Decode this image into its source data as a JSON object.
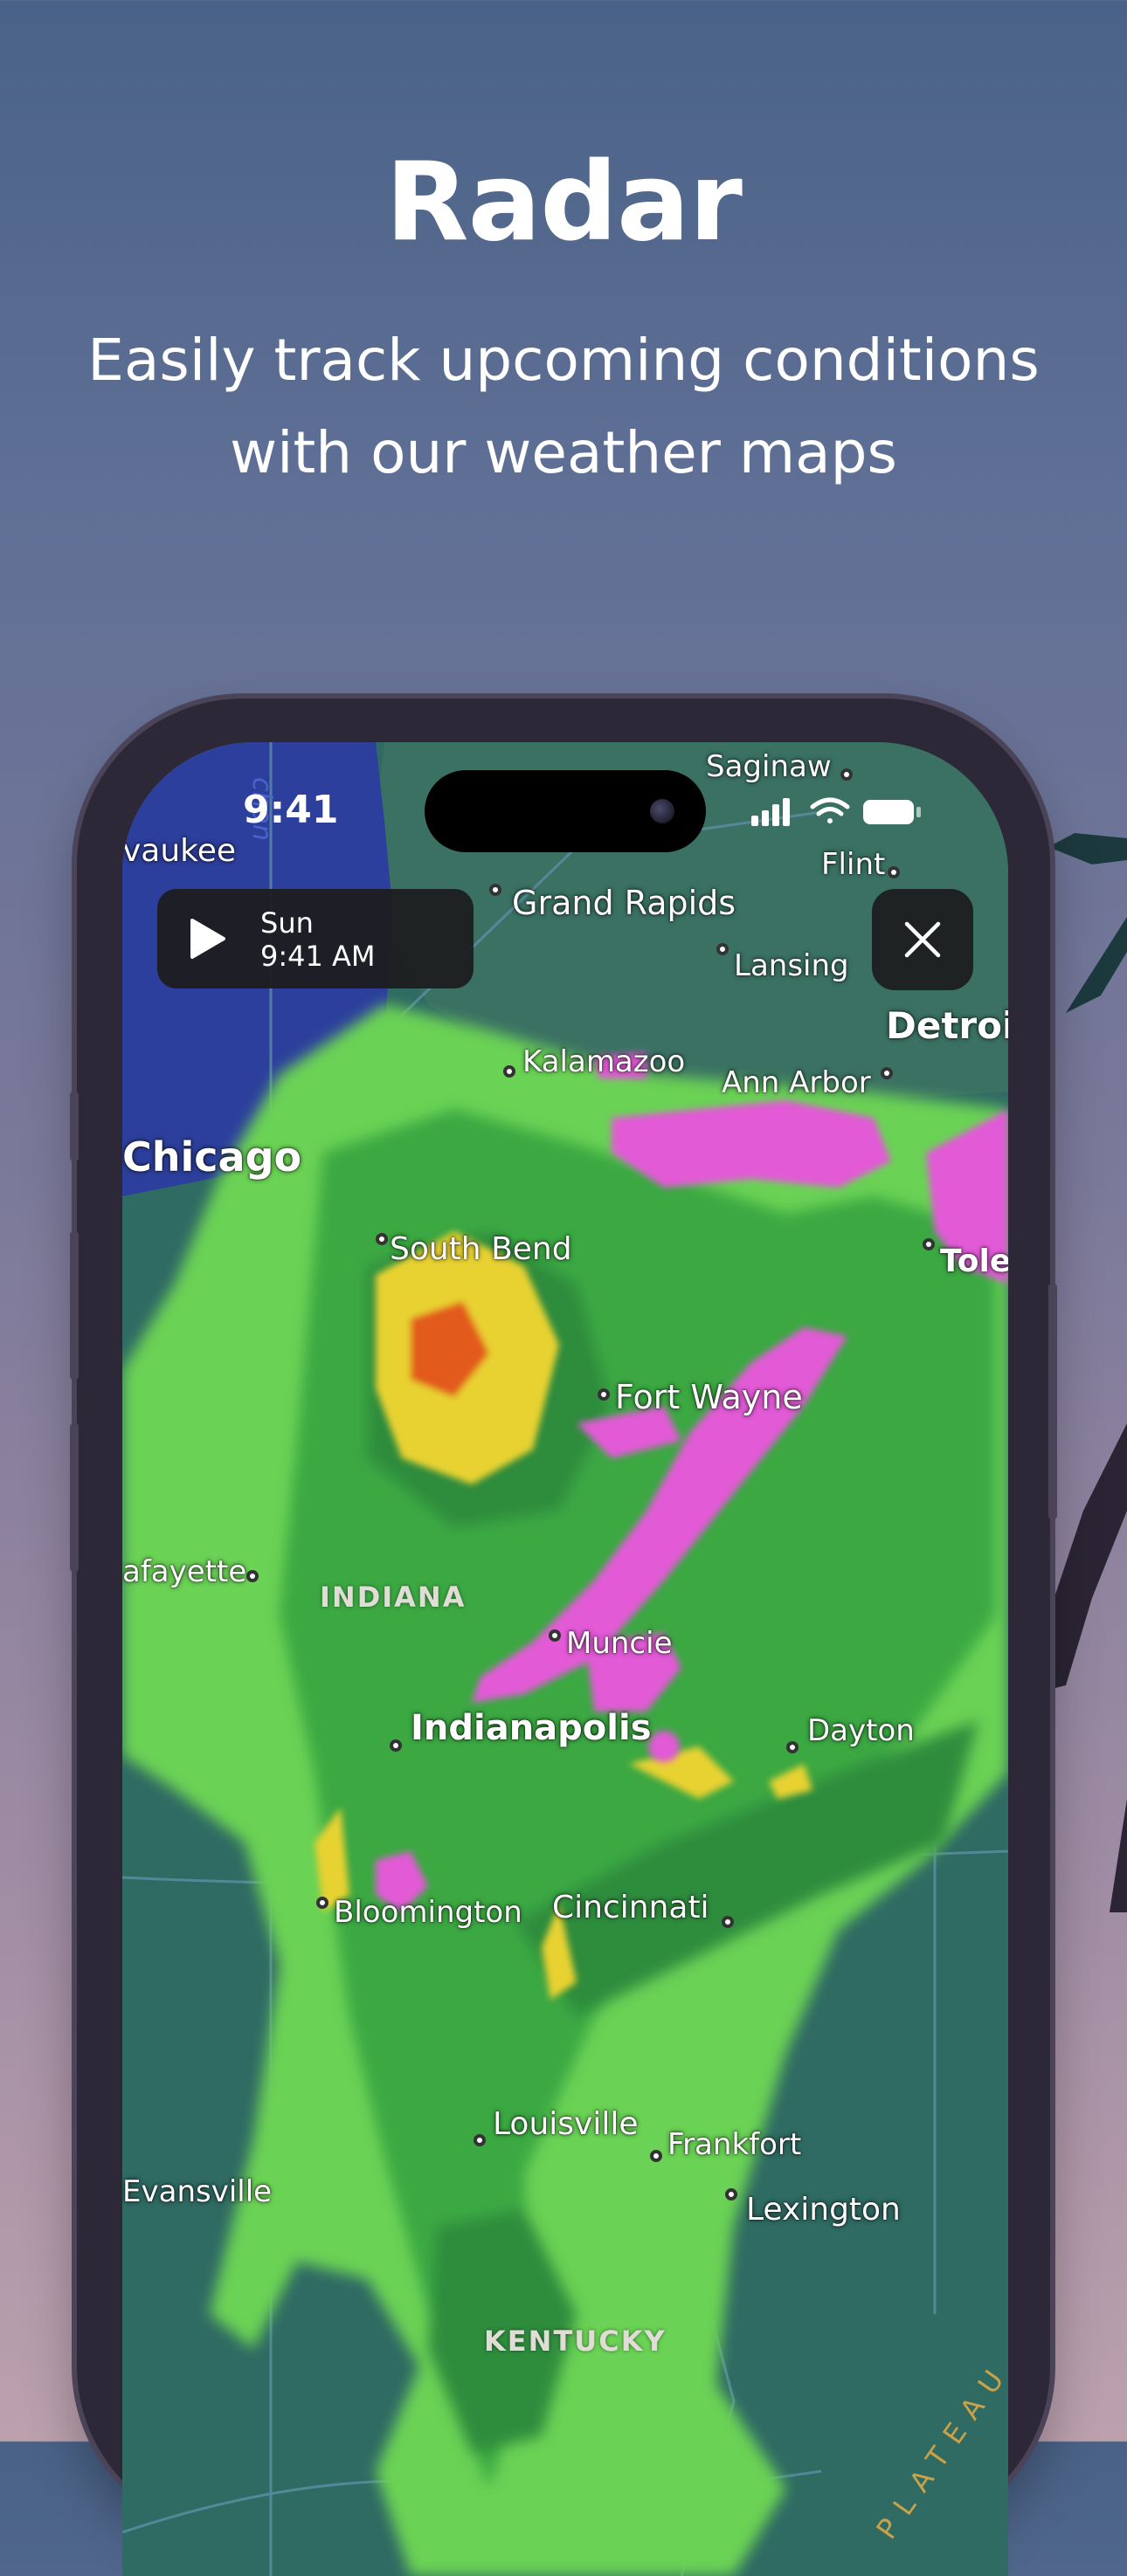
{
  "header": {
    "title": "Radar",
    "subtitle_line1": "Easily track upcoming conditions",
    "subtitle_line2": "with our weather maps"
  },
  "status_bar": {
    "time": "9:41"
  },
  "player": {
    "day": "Sun",
    "time": "9:41 AM"
  },
  "map": {
    "cities": [
      {
        "id": "saginaw",
        "name": "Saginaw"
      },
      {
        "id": "flint",
        "name": "Flint"
      },
      {
        "id": "milwaukee",
        "name": "vaukee"
      },
      {
        "id": "grand-rapids",
        "name": "Grand Rapids"
      },
      {
        "id": "lansing",
        "name": "Lansing"
      },
      {
        "id": "detroit",
        "name": "Detroit"
      },
      {
        "id": "kalamazoo",
        "name": "Kalamazoo"
      },
      {
        "id": "ann-arbor",
        "name": "Ann Arbor"
      },
      {
        "id": "chicago",
        "name": "Chicago"
      },
      {
        "id": "south-bend",
        "name": "South Bend"
      },
      {
        "id": "toledo",
        "name": "Tole"
      },
      {
        "id": "fort-wayne",
        "name": "Fort Wayne"
      },
      {
        "id": "lafayette",
        "name": "afayette"
      },
      {
        "id": "muncie",
        "name": "Muncie"
      },
      {
        "id": "indianapolis",
        "name": "Indianapolis"
      },
      {
        "id": "dayton",
        "name": "Dayton"
      },
      {
        "id": "bloomington",
        "name": "Bloomington"
      },
      {
        "id": "cincinnati",
        "name": "Cincinnati"
      },
      {
        "id": "louisville",
        "name": "Louisville"
      },
      {
        "id": "frankfort",
        "name": "Frankfort"
      },
      {
        "id": "evansville",
        "name": "Evansville"
      },
      {
        "id": "lexington",
        "name": "Lexington"
      }
    ],
    "states": [
      {
        "id": "indiana",
        "name": "INDIANA"
      },
      {
        "id": "kentucky",
        "name": "KENTUCKY"
      }
    ],
    "water_label": "chan",
    "region_label": "PLATEAU"
  },
  "colors": {
    "radar_light": "#7ee05a",
    "radar_medium": "#3aa842",
    "radar_heavy": "#e8d230",
    "radar_intense": "#e25a1e",
    "radar_mixed": "#e25ad6",
    "lake": "#2c3f9c"
  }
}
